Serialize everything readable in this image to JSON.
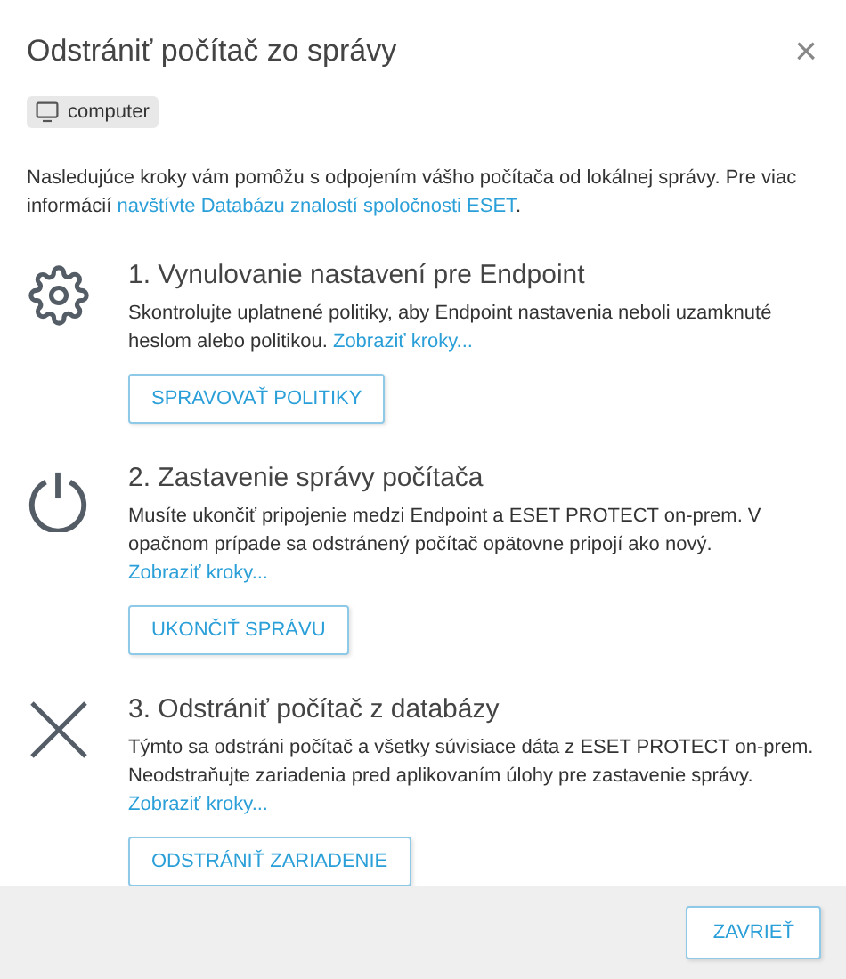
{
  "dialog": {
    "title": "Odstrániť počítač zo správy",
    "close": "×"
  },
  "device": {
    "name": "computer"
  },
  "intro": {
    "text": "Nasledujúce kroky vám pomôžu s odpojením vášho počítača od lokálnej správy. Pre viac informácií ",
    "link": "navštívte Databázu znalostí spoločnosti ESET",
    "end": "."
  },
  "steps": [
    {
      "kind": "gear",
      "title": "1. Vynulovanie nastavení pre Endpoint",
      "text": "Skontrolujte uplatnené politiky, aby Endpoint nastavenia neboli uzamknuté heslom alebo politikou. ",
      "link": "Zobraziť kroky...",
      "button": "SPRAVOVAŤ POLITIKY"
    },
    {
      "kind": "power",
      "title": "2. Zastavenie správy počítača",
      "text": "Musíte ukončiť pripojenie medzi Endpoint a ESET PROTECT on-prem. V opačnom prípade sa odstránený počítač opätovne pripojí ako nový. ",
      "link": "Zobraziť kroky...",
      "button": "UKONČIŤ SPRÁVU"
    },
    {
      "kind": "cross",
      "title": "3. Odstrániť počítač z databázy",
      "text": "Týmto sa odstráni počítač a všetky súvisiace dáta z ESET PROTECT on-prem. Neodstraňujte zariadenia pred aplikovaním úlohy pre zastavenie správy. ",
      "link": "Zobraziť kroky...",
      "button": "ODSTRÁNIŤ ZARIADENIE"
    }
  ],
  "footer": {
    "button": "ZAVRIEŤ"
  }
}
